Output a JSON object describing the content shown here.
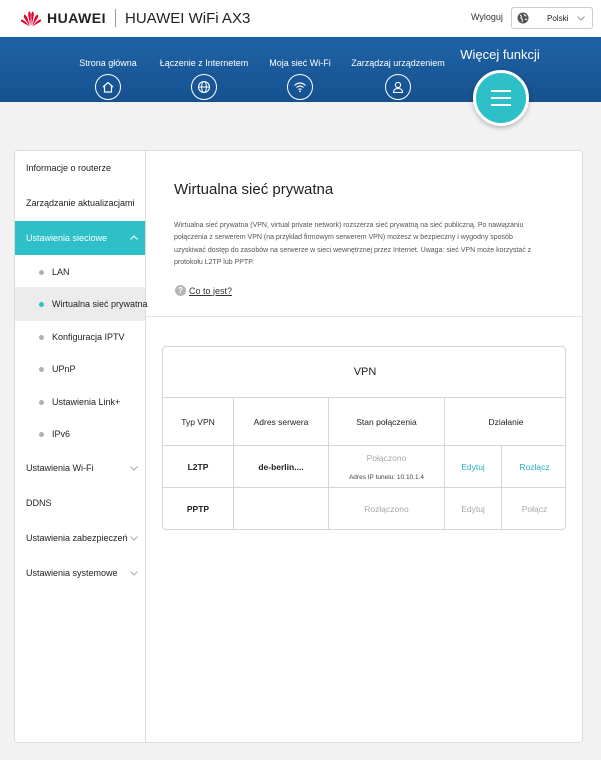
{
  "header": {
    "brand": "HUAWEI",
    "product": "HUAWEI WiFi AX3",
    "logout_label": "Wyloguj",
    "language": "Polski"
  },
  "nav": {
    "items": [
      {
        "label": "Strona główna",
        "icon": "home-icon"
      },
      {
        "label": "Łączenie z Internetem",
        "icon": "globe-icon"
      },
      {
        "label": "Moja sieć Wi-Fi",
        "icon": "wifi-icon"
      },
      {
        "label": "Zarządzaj urządzeniem",
        "icon": "user-icon"
      }
    ],
    "more_label": "Więcej funkcji",
    "more_icon": "menu-icon"
  },
  "sidebar": {
    "items": [
      {
        "label": "Informacje o routerze"
      },
      {
        "label": "Zarządzanie aktualizacjami"
      },
      {
        "label": "Ustawienia sieciowe",
        "expanded": true,
        "active": true
      },
      {
        "label": "LAN"
      },
      {
        "label": "Wirtualna sieć prywatna",
        "selected": true
      },
      {
        "label": "Konfiguracja IPTV"
      },
      {
        "label": "UPnP"
      },
      {
        "label": "Ustawienia Link+"
      },
      {
        "label": "IPv6"
      },
      {
        "label": "Ustawienia Wi-Fi"
      },
      {
        "label": "DDNS"
      },
      {
        "label": "Ustawienia zabezpieczeń"
      },
      {
        "label": "Ustawienia systemowe"
      }
    ]
  },
  "main": {
    "title": "Wirtualna sieć prywatna",
    "description": "Wirtualna sieć prywatna (VPN, virtual private network) rozszerza sieć prywatną na sieć publiczną. Po nawiązaniu połączenia z serwerem VPN (na przykład firmowym serwerem VPN) możesz w bezpieczny i wygodny sposób uzyskiwać dostęp do zasobów na serwerze w sieci wewnętrznej przez Internet. Uwaga: sieć VPN może korzystać z protokołu L2TP lub PPTP.",
    "help_link": "Co to jest?",
    "vpn": {
      "title": "VPN",
      "columns": [
        "Typ VPN",
        "Adres serwera",
        "Stan połączenia",
        "Działanie"
      ],
      "rows": [
        {
          "type": "L2TP",
          "server": "de-berlin....",
          "status": "Połączono",
          "status_detail": "Adres IP tunelu: 10.10.1.4",
          "edit": "Edytuj",
          "action": "Rozłącz"
        },
        {
          "type": "PPTP",
          "server": "",
          "status": "Rozłączono",
          "status_detail": "",
          "edit": "Edytuj",
          "action": "Połącz"
        }
      ]
    }
  },
  "colors": {
    "accent": "#2ec0c8",
    "nav_bg": "#1a5a9c",
    "brand_red": "#e4002b"
  }
}
